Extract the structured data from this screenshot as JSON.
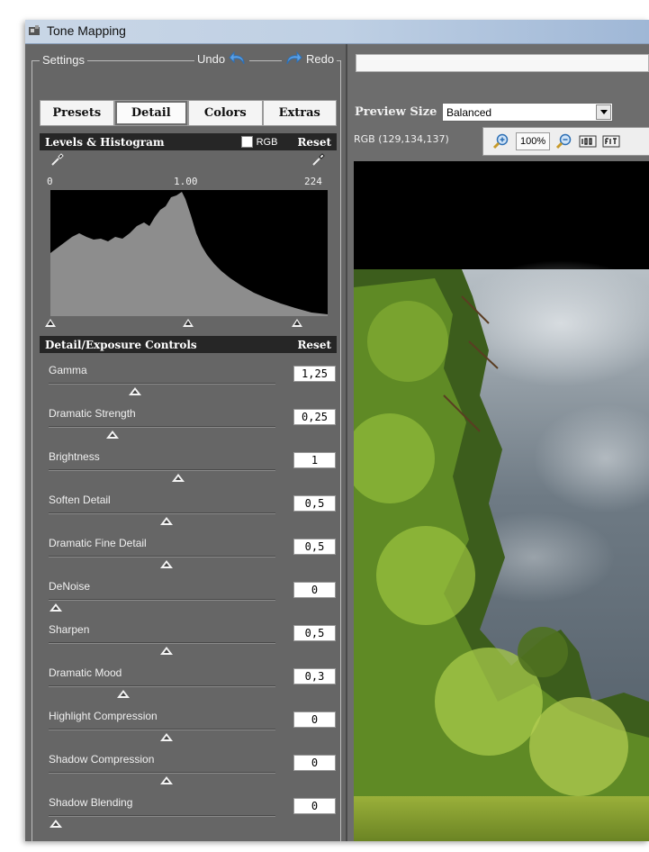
{
  "window": {
    "title": "Tone Mapping"
  },
  "settings": {
    "label": "Settings",
    "undo_label": "Undo",
    "redo_label": "Redo",
    "tabs": [
      {
        "label": "Presets",
        "active": false
      },
      {
        "label": "Detail",
        "active": true
      },
      {
        "label": "Colors",
        "active": false
      },
      {
        "label": "Extras",
        "active": false
      }
    ]
  },
  "levels": {
    "title": "Levels & Histogram",
    "rgb_label": "RGB",
    "rgb_checked": false,
    "reset_label": "Reset",
    "ticks": [
      "0",
      "1.00",
      "224"
    ]
  },
  "detail": {
    "title": "Detail/Exposure Controls",
    "reset_label": "Reset",
    "controls": [
      {
        "label": "Gamma",
        "value": "1,25",
        "level": 0.38
      },
      {
        "label": "Dramatic Strength",
        "value": "0,25",
        "level": 0.28
      },
      {
        "label": "Brightness",
        "value": "1",
        "level": 0.57
      },
      {
        "label": "Soften Detail",
        "value": "0,5",
        "level": 0.52
      },
      {
        "label": "Dramatic Fine Detail",
        "value": "0,5",
        "level": 0.52
      },
      {
        "label": "DeNoise",
        "value": "0",
        "level": 0.03
      },
      {
        "label": "Sharpen",
        "value": "0,5",
        "level": 0.52
      },
      {
        "label": "Dramatic Mood",
        "value": "0,3",
        "level": 0.33
      },
      {
        "label": "Highlight Compression",
        "value": "0",
        "level": 0.52
      },
      {
        "label": "Shadow Compression",
        "value": "0",
        "level": 0.52
      },
      {
        "label": "Shadow Blending",
        "value": "0",
        "level": 0.03
      }
    ]
  },
  "preview": {
    "size_label": "Preview Size",
    "size_value": "Balanced",
    "rgb_readout": "RGB (129,134,137)",
    "zoom_value": "100%"
  }
}
